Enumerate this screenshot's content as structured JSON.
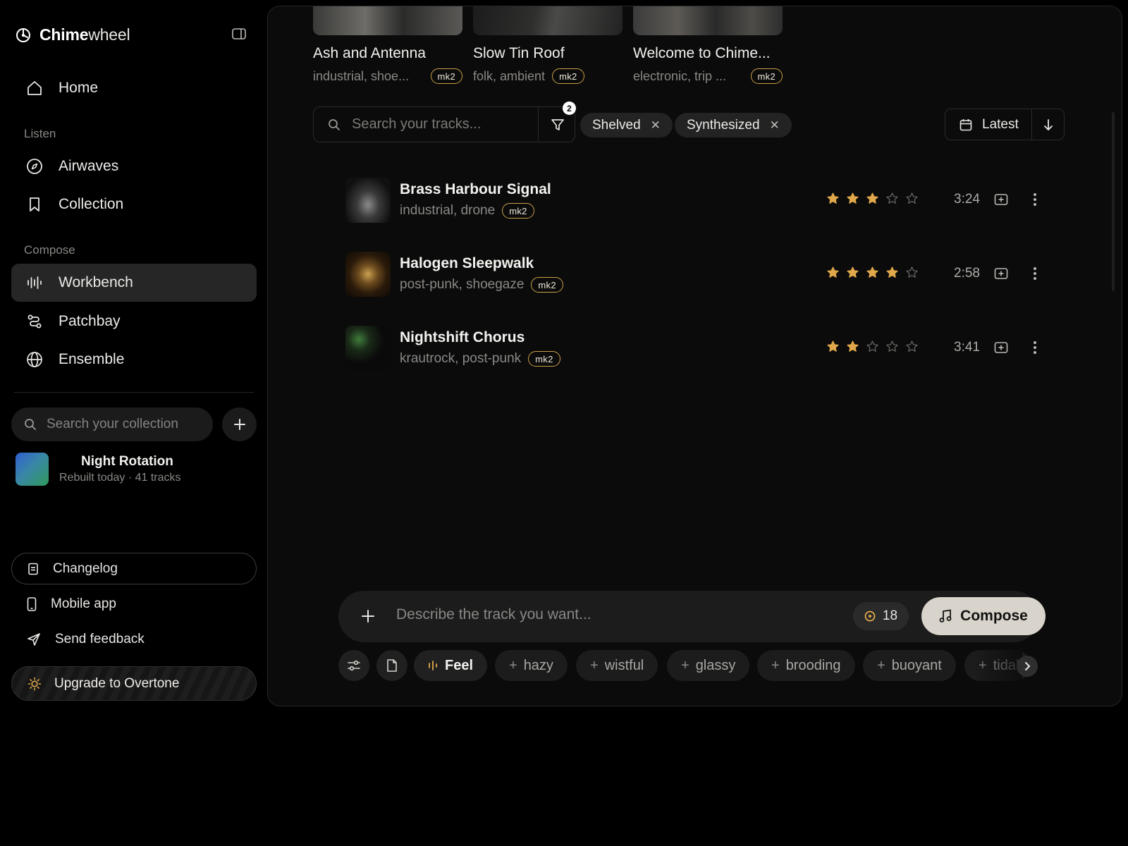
{
  "app": {
    "name_bold": "Chime",
    "name_light": "wheel",
    "accent": "#e0a84a"
  },
  "sidebar": {
    "home": "Home",
    "listen_label": "Listen",
    "listen_items": [
      {
        "label": "Airwaves",
        "icon": "compass-icon"
      },
      {
        "label": "Collection",
        "icon": "bookmark-icon"
      }
    ],
    "compose_label": "Compose",
    "compose_items": [
      {
        "label": "Workbench",
        "icon": "waveform-icon",
        "active": true
      },
      {
        "label": "Patchbay",
        "icon": "route-icon"
      },
      {
        "label": "Ensemble",
        "icon": "globe-icon"
      }
    ],
    "search_placeholder": "Search your collection",
    "playlist": {
      "name": "Night Rotation",
      "meta": "Rebuilt today · 41 tracks"
    },
    "footer": {
      "changelog": "Changelog",
      "mobile_app": "Mobile app",
      "send_feedback": "Send feedback",
      "upgrade": "Upgrade to Overtone"
    }
  },
  "cards": [
    {
      "title": "Ash and Antenna",
      "tags": "industrial, shoe...",
      "badge": "mk2"
    },
    {
      "title": "Slow Tin Roof",
      "tags": "folk, ambient",
      "badge": "mk2"
    },
    {
      "title": "Welcome to Chime...",
      "tags": "electronic, trip ...",
      "badge": "mk2"
    }
  ],
  "toolbar": {
    "search_placeholder": "Search your tracks...",
    "filter_count": "2",
    "chips": [
      "Shelved",
      "Synthesized"
    ],
    "sort_label": "Latest"
  },
  "tracks": [
    {
      "title": "Brass Harbour Signal",
      "tags": "industrial, drone",
      "badge": "mk2",
      "rating": 3,
      "duration": "3:24"
    },
    {
      "title": "Halogen Sleepwalk",
      "tags": "post-punk, shoegaze",
      "badge": "mk2",
      "rating": 4,
      "duration": "2:58"
    },
    {
      "title": "Nightshift Chorus",
      "tags": "krautrock, post-punk",
      "badge": "mk2",
      "rating": 2,
      "duration": "3:41"
    }
  ],
  "composer": {
    "placeholder": "Describe the track you want...",
    "credits": "18",
    "button": "Compose",
    "feel": "Feel",
    "moods": [
      "hazy",
      "wistful",
      "glassy",
      "brooding",
      "buoyant",
      "tidal"
    ]
  }
}
